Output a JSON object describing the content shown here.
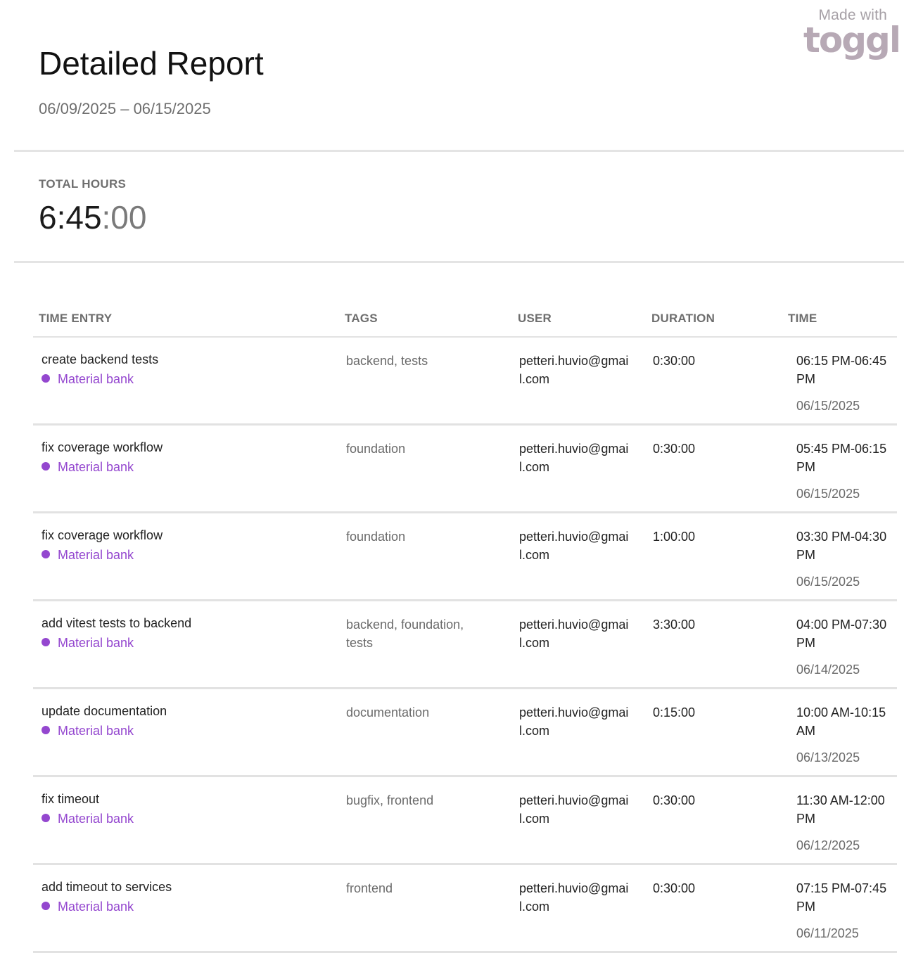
{
  "brand": {
    "made_with": "Made with",
    "logo": "toggl"
  },
  "report": {
    "title": "Detailed Report",
    "date_range": "06/09/2025 – 06/15/2025",
    "total_label": "TOTAL HOURS",
    "total_main": "6:45",
    "total_seconds": ":00"
  },
  "columns": {
    "entry": "TIME ENTRY",
    "tags": "TAGS",
    "user": "USER",
    "duration": "DURATION",
    "time": "TIME"
  },
  "project_color": "#9447cf",
  "entries": [
    {
      "description": "create backend tests",
      "project": "Material bank",
      "tags": "backend, tests",
      "user": "petteri.huvio@gmail.com",
      "duration": "0:30:00",
      "time_range": "06:15 PM-06:45 PM",
      "date": "06/15/2025"
    },
    {
      "description": "fix coverage workflow",
      "project": "Material bank",
      "tags": "foundation",
      "user": "petteri.huvio@gmail.com",
      "duration": "0:30:00",
      "time_range": "05:45 PM-06:15 PM",
      "date": "06/15/2025"
    },
    {
      "description": "fix coverage workflow",
      "project": "Material bank",
      "tags": "foundation",
      "user": "petteri.huvio@gmail.com",
      "duration": "1:00:00",
      "time_range": "03:30 PM-04:30 PM",
      "date": "06/15/2025"
    },
    {
      "description": "add vitest tests to backend",
      "project": "Material bank",
      "tags": "backend, foundation, tests",
      "user": "petteri.huvio@gmail.com",
      "duration": "3:30:00",
      "time_range": "04:00 PM-07:30 PM",
      "date": "06/14/2025"
    },
    {
      "description": "update documentation",
      "project": "Material bank",
      "tags": "documentation",
      "user": "petteri.huvio@gmail.com",
      "duration": "0:15:00",
      "time_range": "10:00 AM-10:15 AM",
      "date": "06/13/2025"
    },
    {
      "description": "fix timeout",
      "project": "Material bank",
      "tags": "bugfix, frontend",
      "user": "petteri.huvio@gmail.com",
      "duration": "0:30:00",
      "time_range": "11:30 AM-12:00 PM",
      "date": "06/12/2025"
    },
    {
      "description": "add timeout to services",
      "project": "Material bank",
      "tags": "frontend",
      "user": "petteri.huvio@gmail.com",
      "duration": "0:30:00",
      "time_range": "07:15 PM-07:45 PM",
      "date": "06/11/2025"
    }
  ]
}
